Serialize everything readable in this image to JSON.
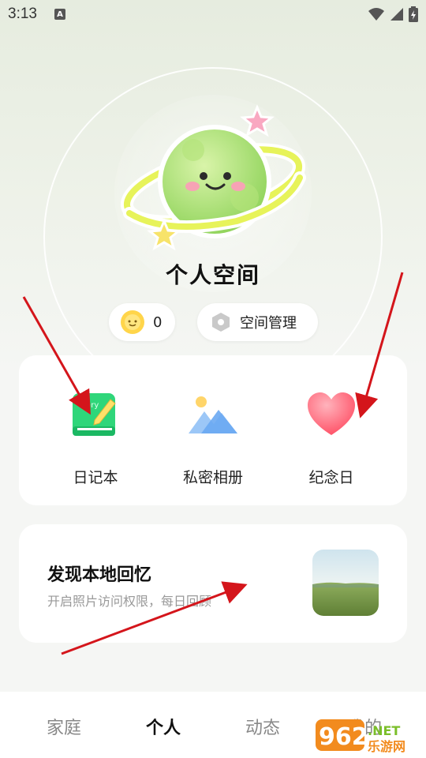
{
  "status": {
    "time": "3:13",
    "notification_letter": "A",
    "icons": [
      "wifi-icon",
      "signal-icon",
      "battery-icon"
    ]
  },
  "space": {
    "title": "个人空间",
    "avatar": "planet-mascot-icon"
  },
  "pills": {
    "coin_count": "0",
    "coin_icon": "sun-coin-icon",
    "manage_label": "空间管理",
    "manage_icon": "hexagon-icon"
  },
  "features": [
    {
      "label": "日记本",
      "icon": "diary-icon",
      "icon_text": "diary"
    },
    {
      "label": "私密相册",
      "icon": "photo-album-icon"
    },
    {
      "label": "纪念日",
      "icon": "heart-icon"
    }
  ],
  "memory": {
    "title": "发现本地回忆",
    "subtitle": "开启照片访问权限，每日回顾",
    "thumb": "landscape-photo"
  },
  "tabs": [
    {
      "label": "家庭",
      "active": false
    },
    {
      "label": "个人",
      "active": true
    },
    {
      "label": "动态",
      "active": false
    },
    {
      "label": "我的",
      "active": false
    }
  ],
  "watermark": {
    "number": "962",
    "suffix": ".NET",
    "site": "乐游网"
  },
  "colors": {
    "accent_green": "#8fd35a",
    "heart_red": "#ff5a6e",
    "annotation_arrow": "#d4151b"
  }
}
